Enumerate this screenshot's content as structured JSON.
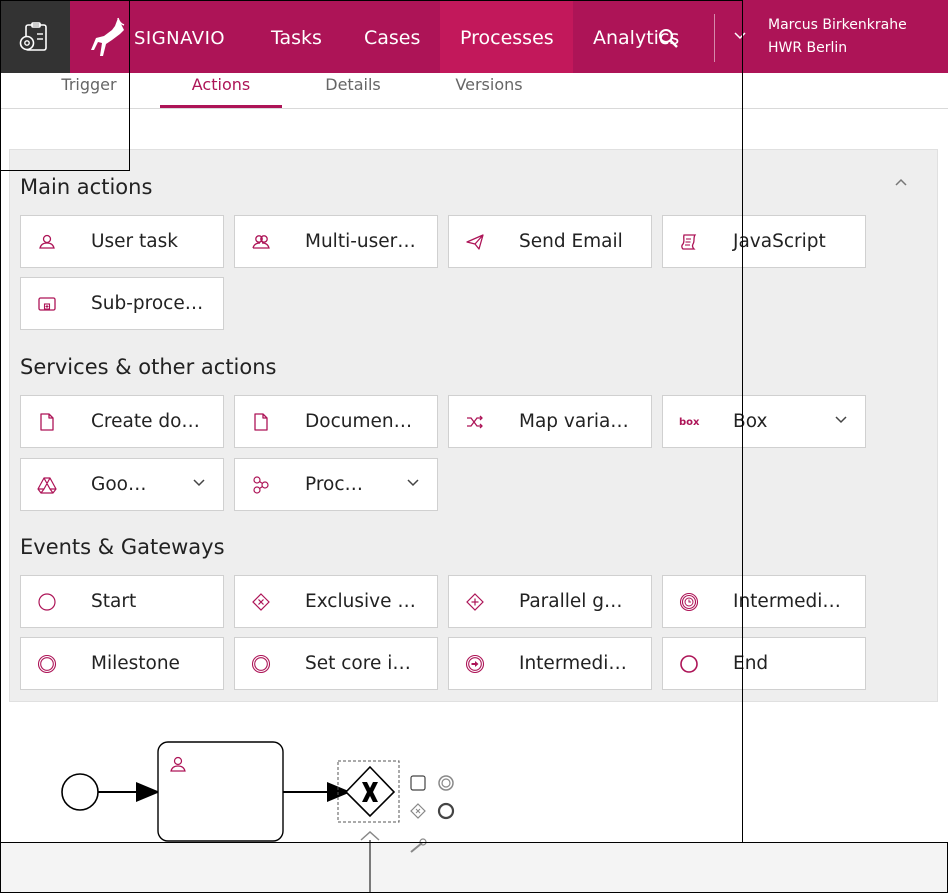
{
  "app": {
    "brand": "SIGNAVIO",
    "nav": [
      {
        "label": "Tasks"
      },
      {
        "label": "Cases"
      },
      {
        "label": "Processes",
        "active": true
      },
      {
        "label": "Analytics"
      }
    ],
    "user": {
      "name": "Marcus Birkenkrahe",
      "org": "HWR Berlin"
    }
  },
  "tabs": [
    {
      "label": "Trigger"
    },
    {
      "label": "Actions",
      "active": true
    },
    {
      "label": "Details"
    },
    {
      "label": "Versions"
    }
  ],
  "sections": {
    "main": {
      "title": "Main actions",
      "items": [
        {
          "label": "User task",
          "icon": "user-icon"
        },
        {
          "label": "Multi-user…",
          "icon": "multi-user-icon"
        },
        {
          "label": "Send Email",
          "icon": "send-icon"
        },
        {
          "label": "JavaScript",
          "icon": "script-icon"
        },
        {
          "label": "Sub-proce…",
          "icon": "subprocess-icon"
        }
      ]
    },
    "services": {
      "title": "Services & other actions",
      "items": [
        {
          "label": "Create do…",
          "icon": "document-icon"
        },
        {
          "label": "Documen…",
          "icon": "document-icon"
        },
        {
          "label": "Map varia…",
          "icon": "shuffle-icon"
        },
        {
          "label": "Box",
          "icon": "box-logo-icon"
        },
        {
          "label": "Goo…",
          "icon": "google-drive-icon"
        },
        {
          "label": "Proc…",
          "icon": "process-icon"
        }
      ]
    },
    "events": {
      "title": "Events & Gateways",
      "items": [
        {
          "label": "Start",
          "icon": "start-event-icon"
        },
        {
          "label": "Exclusive …",
          "icon": "exclusive-gateway-icon"
        },
        {
          "label": "Parallel g…",
          "icon": "parallel-gateway-icon"
        },
        {
          "label": "Intermedi…",
          "icon": "timer-event-icon"
        },
        {
          "label": "Milestone",
          "icon": "milestone-icon"
        },
        {
          "label": "Set core i…",
          "icon": "core-info-icon"
        },
        {
          "label": "Intermedi…",
          "icon": "intermediate-event-icon"
        },
        {
          "label": "End",
          "icon": "end-event-icon"
        }
      ]
    }
  },
  "colors": {
    "brand": "#ad1457",
    "brand_active": "#c2185b",
    "gear_bg": "#333333",
    "panel_bg": "#eeeeee"
  }
}
